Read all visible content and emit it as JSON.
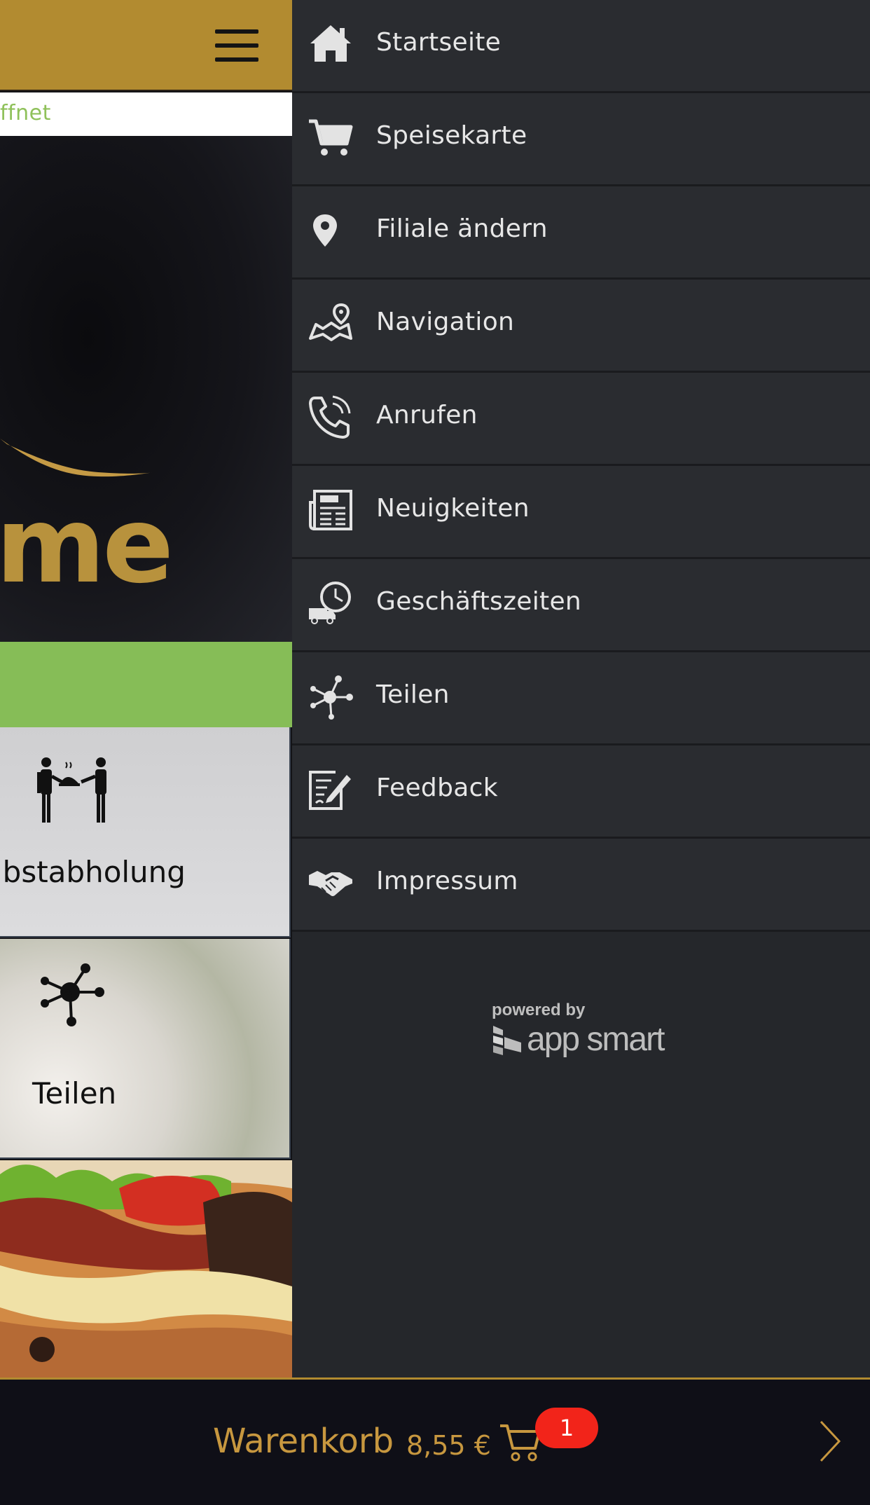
{
  "app": {
    "status_text": "ffnet",
    "logo_text": "me",
    "tiles": [
      {
        "label": "lbstabholung",
        "icon": "pickup-service-icon"
      },
      {
        "label": "Teilen",
        "icon": "share-network-icon"
      }
    ]
  },
  "drawer": {
    "items": [
      {
        "label": "Startseite",
        "icon": "home-icon"
      },
      {
        "label": "Speisekarte",
        "icon": "cart-icon"
      },
      {
        "label": "Filiale ändern",
        "icon": "location-pin-icon"
      },
      {
        "label": "Navigation",
        "icon": "map-icon"
      },
      {
        "label": "Anrufen",
        "icon": "phone-icon"
      },
      {
        "label": "Neuigkeiten",
        "icon": "news-icon"
      },
      {
        "label": "Geschäftszeiten",
        "icon": "delivery-clock-icon"
      },
      {
        "label": "Teilen",
        "icon": "share-icon"
      },
      {
        "label": "Feedback",
        "icon": "feedback-icon"
      },
      {
        "label": "Impressum",
        "icon": "handshake-icon"
      }
    ],
    "powered_by": "powered by",
    "brand": "app smart"
  },
  "cart": {
    "title": "Warenkorb",
    "total": "8,55 €",
    "badge": "1"
  },
  "colors": {
    "accent_gold": "#b28b30",
    "drawer_bg": "#2a2c30",
    "green": "#86bd57",
    "badge_red": "#f2241a"
  }
}
